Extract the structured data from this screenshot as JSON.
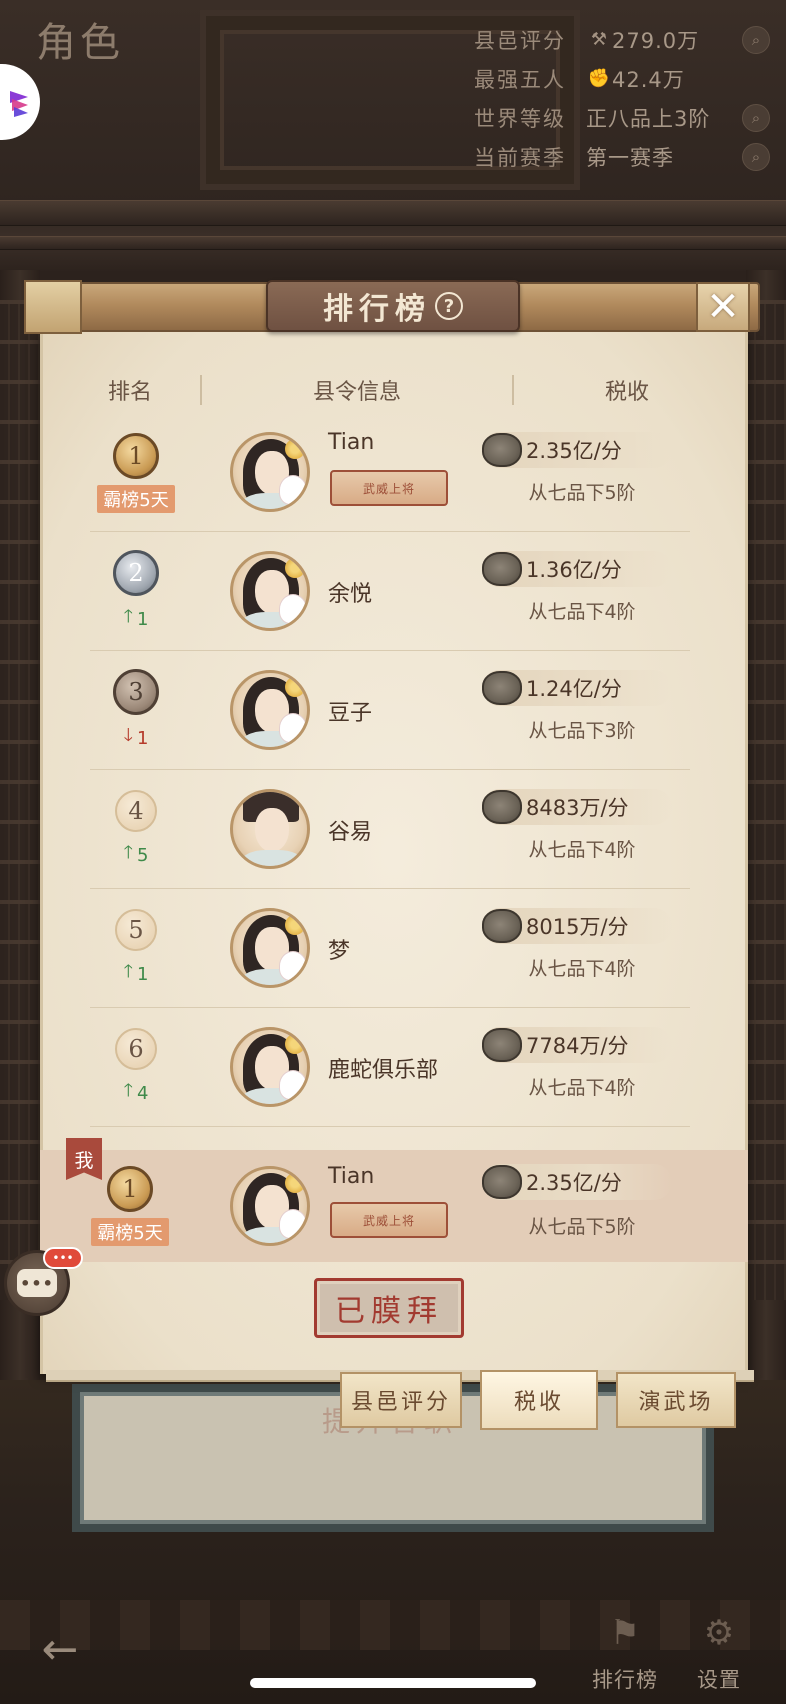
{
  "page": {
    "title": "角色"
  },
  "stats": [
    {
      "label": "县邑评分",
      "icon": "hammer-icon",
      "glyph": "⚒",
      "value": "279.0万"
    },
    {
      "label": "最强五人",
      "icon": "fist-icon",
      "glyph": "✊",
      "value": "42.4万"
    },
    {
      "label": "世界等级",
      "icon": "",
      "glyph": "",
      "value": "正八品上3阶"
    },
    {
      "label": "当前赛季",
      "icon": "",
      "glyph": "",
      "value": "第一赛季"
    }
  ],
  "leaderboard": {
    "title": "排行榜",
    "headers": {
      "rank": "排名",
      "info": "县令信息",
      "tax": "税收"
    },
    "rows": [
      {
        "rank": "1",
        "medal": "gold",
        "streak": "霸榜5天",
        "name": "Tian",
        "badge": "武威上将",
        "tax": "2.35亿/分",
        "grade": "从七品下5阶"
      },
      {
        "rank": "2",
        "medal": "silver",
        "change_dir": "up",
        "change": "1",
        "name": "余悦",
        "tax": "1.36亿/分",
        "grade": "从七品下4阶"
      },
      {
        "rank": "3",
        "medal": "bronze",
        "change_dir": "down",
        "change": "1",
        "name": "豆子",
        "tax": "1.24亿/分",
        "grade": "从七品下3阶"
      },
      {
        "rank": "4",
        "medal": "plain",
        "change_dir": "up",
        "change": "5",
        "name": "谷易",
        "tax": "8483万/分",
        "grade": "从七品下4阶"
      },
      {
        "rank": "5",
        "medal": "plain",
        "change_dir": "up",
        "change": "1",
        "name": "梦",
        "tax": "8015万/分",
        "grade": "从七品下4阶"
      },
      {
        "rank": "6",
        "medal": "plain",
        "change_dir": "up",
        "change": "4",
        "name": "鹿蛇俱乐部",
        "tax": "7784万/分",
        "grade": "从七品下4阶"
      }
    ],
    "me": {
      "tag": "我",
      "rank": "1",
      "streak": "霸榜5天",
      "name": "Tian",
      "badge": "武威上将",
      "tax": "2.35亿/分",
      "grade": "从七品下5阶"
    },
    "worship_label": "已膜拜"
  },
  "tabs": [
    {
      "label": "县邑评分",
      "active": false
    },
    {
      "label": "税收",
      "active": true
    },
    {
      "label": "演武场",
      "active": false
    }
  ],
  "background_text": "提升官职",
  "nav": [
    {
      "label": "排行榜",
      "icon": "leaderboard-icon"
    },
    {
      "label": "设置",
      "icon": "settings-gear-icon"
    }
  ],
  "colors": {
    "accent_red": "#a23a30",
    "streak_orange": "#e39a6e",
    "up_green": "#3f8a4a",
    "down_red": "#b53a2a",
    "paper": "#efe6d3"
  }
}
